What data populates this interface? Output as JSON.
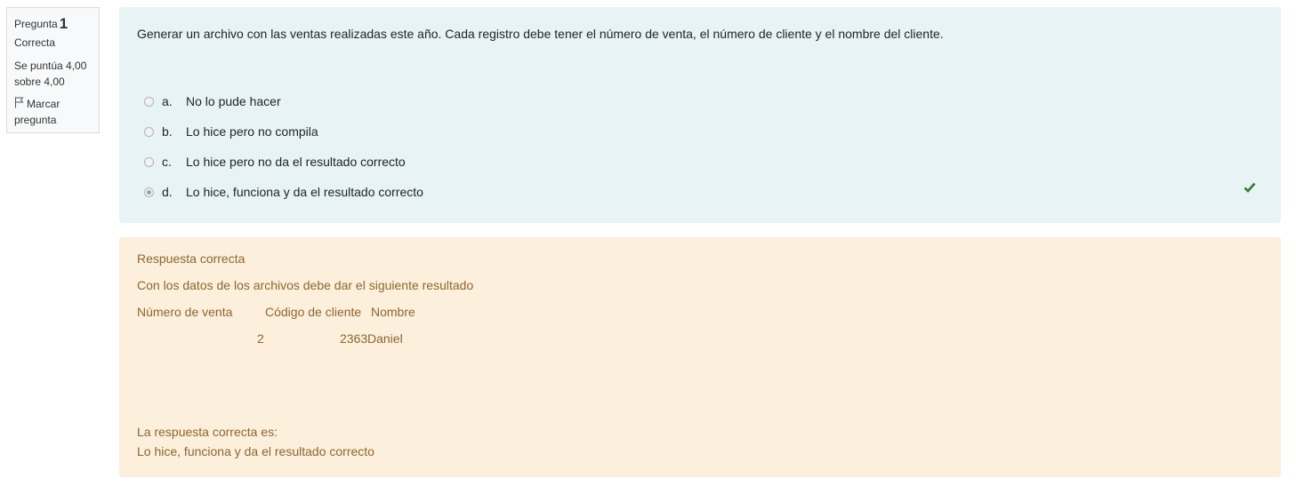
{
  "info": {
    "question_label": "Pregunta",
    "question_number": "1",
    "state": "Correcta",
    "grade_line1": "Se puntúa 4,00",
    "grade_line2": "sobre 4,00",
    "flag_line1": "Marcar",
    "flag_line2": "pregunta",
    "flag_icon": "flag-icon"
  },
  "question": {
    "text": "Generar un archivo con las ventas realizadas este año. Cada registro debe tener el número de venta, el número de cliente y el nombre del cliente.",
    "options": [
      {
        "letter": "a.",
        "label": "No lo pude hacer",
        "selected": false
      },
      {
        "letter": "b.",
        "label": "Lo hice pero no compila",
        "selected": false
      },
      {
        "letter": "c.",
        "label": "Lo hice pero no da el resultado correcto",
        "selected": false
      },
      {
        "letter": "d.",
        "label": "Lo hice, funciona y da el resultado correcto",
        "selected": true
      }
    ],
    "correct_icon": "check-icon",
    "correct_color": "#357a32"
  },
  "feedback": {
    "title": "Respuesta correcta",
    "intro": "Con los datos de los archivos debe dar el siguiente resultado",
    "headers": [
      "Número de venta",
      "Código de cliente",
      "Nombre"
    ],
    "row": [
      "2",
      "2363",
      "Daniel"
    ],
    "right_answer_label": "La respuesta correcta es:",
    "right_answer_text": "Lo hice, funciona y da el resultado correcto",
    "background_color": "#fcefdc",
    "text_color": "#8e662e"
  }
}
